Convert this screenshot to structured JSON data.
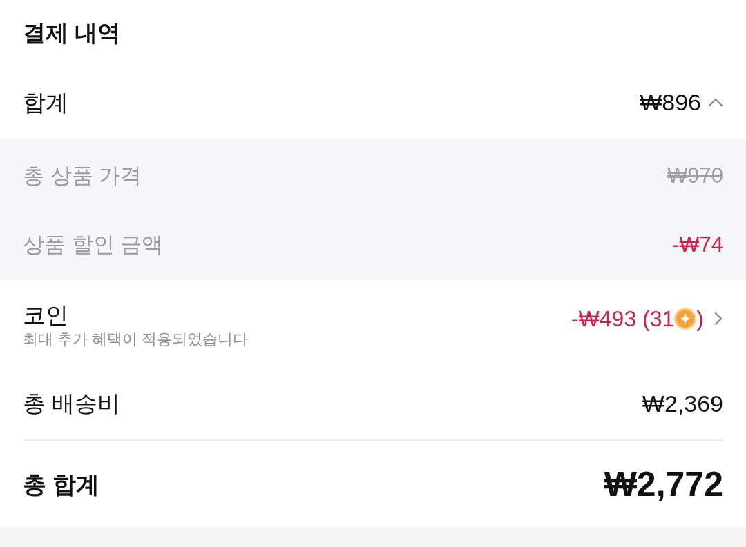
{
  "title": "결제 내역",
  "subtotal": {
    "label": "합계",
    "value": "₩896",
    "expanded": true
  },
  "breakdown": [
    {
      "kind": "original",
      "label": "총 상품 가격",
      "value": "₩970"
    },
    {
      "kind": "discount",
      "label": "상품 할인 금액",
      "value": "-₩74"
    }
  ],
  "coins": {
    "label": "코인",
    "note": "최대 추가 혜택이 적용되었습니다",
    "value": "-₩493 (31",
    "value_end": ")"
  },
  "shipping": {
    "label": "총 배송비",
    "value": "₩2,369"
  },
  "total": {
    "label": "총 합계",
    "value": "₩2,772"
  }
}
